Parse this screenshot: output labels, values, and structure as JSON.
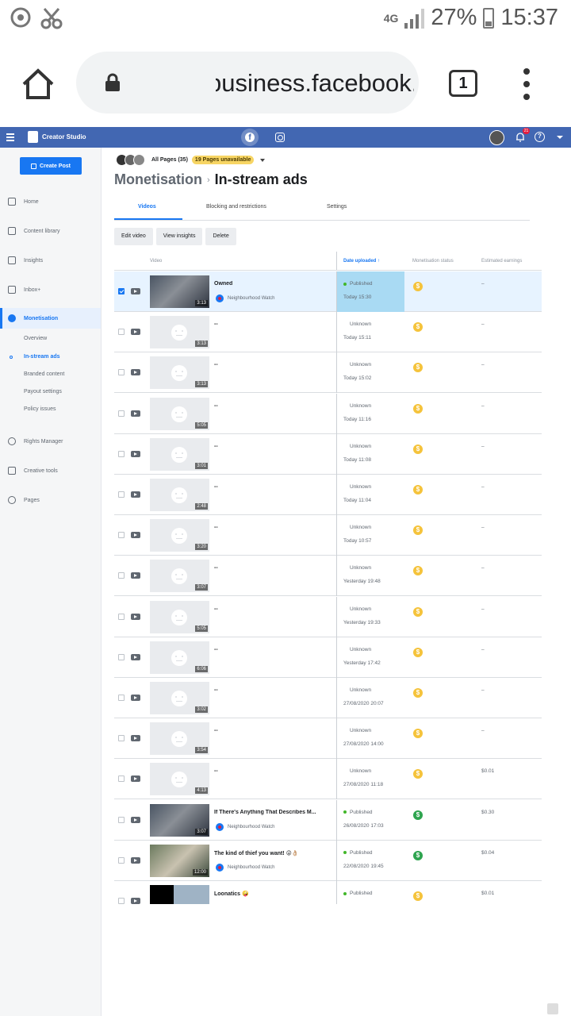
{
  "statusbar": {
    "network": "4G",
    "battery": "27%",
    "time": "15:37"
  },
  "browser": {
    "url": "business.facebook.com",
    "tab_count": "1"
  },
  "header": {
    "app_title": "Creator Studio",
    "notification_count": "21"
  },
  "sidebar": {
    "create_label": "Create Post",
    "items": [
      {
        "label": "Home",
        "icon": "home-icon"
      },
      {
        "label": "Content library",
        "icon": "library-icon"
      },
      {
        "label": "Insights",
        "icon": "insights-icon"
      },
      {
        "label": "Inbox+",
        "icon": "inbox-icon"
      },
      {
        "label": "Monetisation",
        "icon": "dollar-icon"
      },
      {
        "label": "Rights Manager",
        "icon": "copyright-icon"
      },
      {
        "label": "Creative tools",
        "icon": "tools-icon"
      },
      {
        "label": "Pages",
        "icon": "pages-icon"
      }
    ],
    "subitems": [
      {
        "label": "Overview"
      },
      {
        "label": "In-stream ads"
      },
      {
        "label": "Branded content"
      },
      {
        "label": "Payout settings"
      },
      {
        "label": "Policy issues"
      }
    ]
  },
  "pages_selector": {
    "label": "All Pages (35)",
    "warning": "19 Pages unavailable"
  },
  "breadcrumb": {
    "parent": "Monetisation",
    "current": "In-stream ads"
  },
  "tabs": [
    {
      "label": "Videos"
    },
    {
      "label": "Blocking and restrictions"
    },
    {
      "label": "Settings"
    }
  ],
  "actions": {
    "edit": "Edit video",
    "insights": "View insights",
    "delete": "Delete"
  },
  "table": {
    "headers": {
      "video": "Video",
      "date": "Date uploaded ↑",
      "status": "Monetisation status",
      "earnings": "Estimated earnings"
    },
    "rows": [
      {
        "title": "Owned",
        "page": "Neighbourhood Watch",
        "duration": "3:13",
        "status": "Published",
        "date": "Today 15:30",
        "earnings": "–",
        "mon": "$"
      },
      {
        "title": "--",
        "page": "",
        "duration": "3:13",
        "status": "Unknown",
        "date": "Today 15:11",
        "earnings": "–",
        "mon": "$"
      },
      {
        "title": "--",
        "page": "",
        "duration": "3:13",
        "status": "Unknown",
        "date": "Today 15:02",
        "earnings": "–",
        "mon": "$"
      },
      {
        "title": "--",
        "page": "",
        "duration": "5:05",
        "status": "Unknown",
        "date": "Today 11:16",
        "earnings": "–",
        "mon": "$"
      },
      {
        "title": "--",
        "page": "",
        "duration": "3:01",
        "status": "Unknown",
        "date": "Today 11:08",
        "earnings": "–",
        "mon": "$"
      },
      {
        "title": "--",
        "page": "",
        "duration": "2:48",
        "status": "Unknown",
        "date": "Today 11:04",
        "earnings": "–",
        "mon": "$"
      },
      {
        "title": "--",
        "page": "",
        "duration": "3:20",
        "status": "Unknown",
        "date": "Today 10:57",
        "earnings": "–",
        "mon": "$"
      },
      {
        "title": "--",
        "page": "",
        "duration": "3:07",
        "status": "Unknown",
        "date": "Yesterday 19:48",
        "earnings": "–",
        "mon": "$"
      },
      {
        "title": "--",
        "page": "",
        "duration": "5:05",
        "status": "Unknown",
        "date": "Yesterday 19:33",
        "earnings": "–",
        "mon": "$"
      },
      {
        "title": "--",
        "page": "",
        "duration": "6:06",
        "status": "Unknown",
        "date": "Yesterday 17:42",
        "earnings": "–",
        "mon": "$"
      },
      {
        "title": "--",
        "page": "",
        "duration": "3:02",
        "status": "Unknown",
        "date": "27/08/2020 20:07",
        "earnings": "–",
        "mon": "$"
      },
      {
        "title": "--",
        "page": "",
        "duration": "3:54",
        "status": "Unknown",
        "date": "27/08/2020 14:00",
        "earnings": "–",
        "mon": "$"
      },
      {
        "title": "--",
        "page": "",
        "duration": "4:13",
        "status": "Unknown",
        "date": "27/08/2020 11:18",
        "earnings": "$0.01",
        "mon": "$"
      },
      {
        "title": "If There's Anything That Describes M...",
        "page": "Neighbourhood Watch",
        "duration": "3:07",
        "status": "Published",
        "date": "26/08/2020 17:03",
        "earnings": "$0.30",
        "mon": "$"
      },
      {
        "title": "The kind of thief you want! 😜👌🏼",
        "page": "Neighbourhood Watch",
        "duration": "12:00",
        "status": "Published",
        "date": "22/08/2020 19:45",
        "earnings": "$0.04",
        "mon": "$"
      },
      {
        "title": "Loonatics 🤪",
        "page": "",
        "duration": "",
        "status": "Published",
        "date": "",
        "earnings": "$0.01",
        "mon": "$"
      }
    ]
  }
}
